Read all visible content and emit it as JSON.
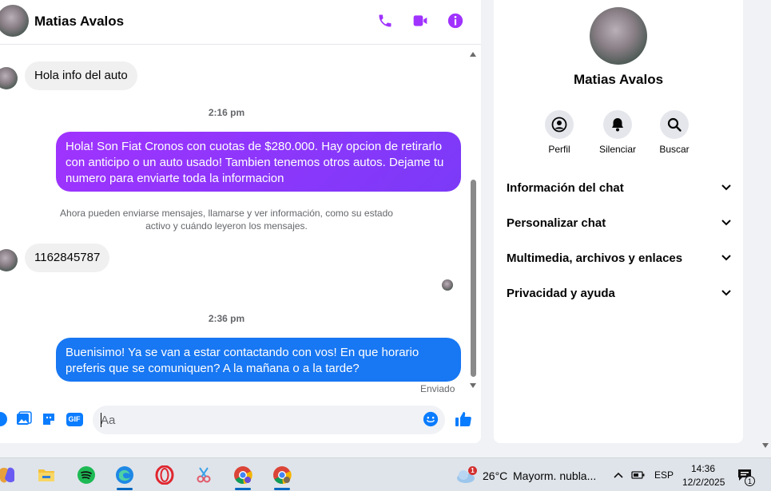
{
  "contact": {
    "name": "Matias Avalos"
  },
  "messages": {
    "incoming_1": "Hola info del auto",
    "time_1": "2:16 pm",
    "outgoing_1": "Hola! Son Fiat Cronos con cuotas de $280.000. Hay opcion de retirarlo con anticipo o un auto usado! Tambien tenemos otros autos. Dejame tu numero para enviarte toda la informacion",
    "system_notice": "Ahora pueden enviarse mensajes, llamarse y ver información, como su estado activo y cuándo leyeron los mensajes.",
    "incoming_2": "1162845787",
    "time_2": "2:36 pm",
    "outgoing_2": "Buenisimo! Ya se van a estar contactando con vos! En que horario preferis que se comuniquen? A la mañana o a la tarde?",
    "status": "Enviado"
  },
  "composer": {
    "placeholder": "Aa",
    "gif_label": "GIF"
  },
  "info_panel": {
    "actions": [
      {
        "label": "Perfil",
        "icon": "profile-icon"
      },
      {
        "label": "Silenciar",
        "icon": "bell-icon"
      },
      {
        "label": "Buscar",
        "icon": "search-icon"
      }
    ],
    "sections": [
      "Información del chat",
      "Personalizar chat",
      "Multimedia, archivos y enlaces",
      "Privacidad y ayuda"
    ]
  },
  "colors": {
    "accent": "#a033ff",
    "outgoing_gradient_start": "#a033ff",
    "outgoing_gradient_end": "#7b3af7",
    "outgoing_blue": "#1877f2",
    "composer_blue": "#0a7cff"
  },
  "taskbar": {
    "weather_temp": "26°C",
    "weather_desc": "Mayorm. nubla...",
    "weather_badge": "1",
    "language": "ESP",
    "time": "14:36",
    "date": "12/2/2025",
    "notification_count": "1"
  }
}
